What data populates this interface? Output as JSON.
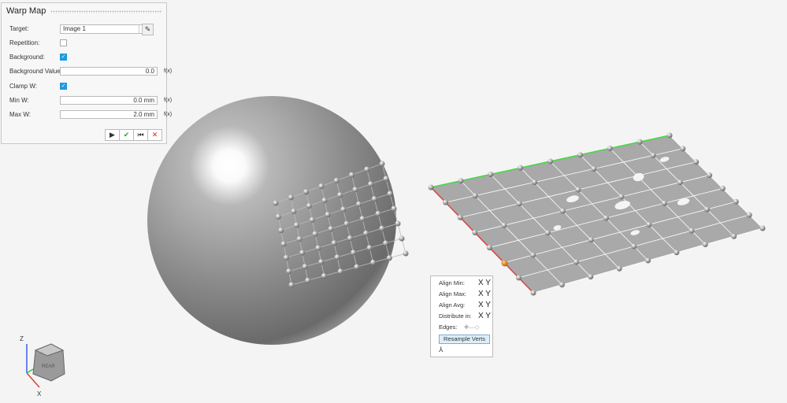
{
  "panel": {
    "title": "Warp Map",
    "target": {
      "label": "Target:",
      "value": "Image 1"
    },
    "repetition": {
      "label": "Repetition:",
      "checked": false
    },
    "background": {
      "label": "Background:",
      "checked": true
    },
    "background_value": {
      "label": "Background Value:",
      "value": "0.0",
      "fx": "f(x)"
    },
    "clamp_w": {
      "label": "Clamp W:",
      "checked": true
    },
    "min_w": {
      "label": "Min W:",
      "value": "0.0 mm",
      "fx": "f(x)"
    },
    "max_w": {
      "label": "Max W:",
      "value": "2.0 mm",
      "fx": "f(x)"
    },
    "check_mark": "✓"
  },
  "align": {
    "min": "Align Min:",
    "max": "Align Max:",
    "avg": "Align Avg:",
    "distribute": "Distribute in:",
    "x": "X",
    "y": "Y",
    "edges": "Edges:",
    "resample": "Resample Verts"
  },
  "viewcube": {
    "face": "REAR",
    "axis_z": "Z",
    "axis_x": "X"
  },
  "colors": {
    "accent": "#1e9be0",
    "green_edge": "#3fdc3f",
    "red_edge": "#e04040",
    "selected_node": "#e08a1a"
  }
}
